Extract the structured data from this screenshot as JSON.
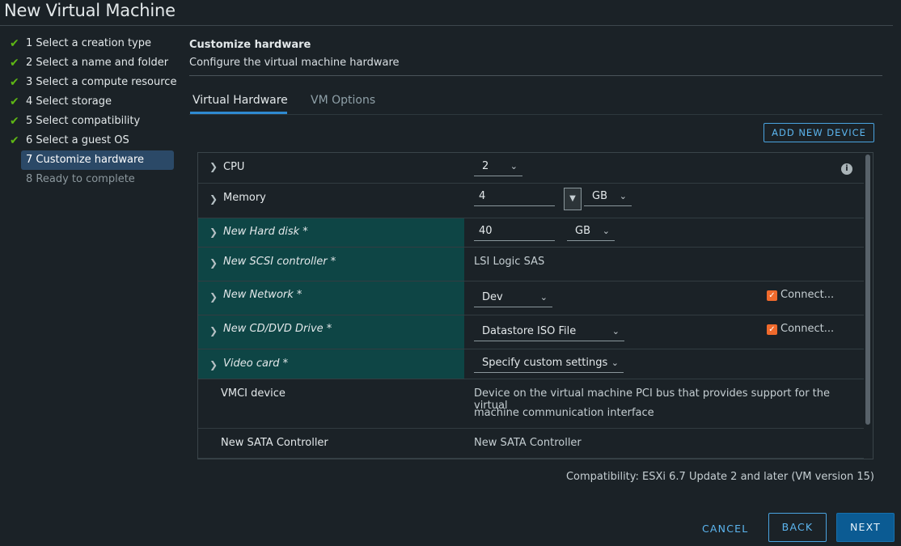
{
  "window": {
    "title": "New Virtual Machine"
  },
  "steps": [
    {
      "label": "1 Select a creation type",
      "state": "done"
    },
    {
      "label": "2 Select a name and folder",
      "state": "done"
    },
    {
      "label": "3 Select a compute resource",
      "state": "done"
    },
    {
      "label": "4 Select storage",
      "state": "done"
    },
    {
      "label": "5 Select compatibility",
      "state": "done"
    },
    {
      "label": "6 Select a guest OS",
      "state": "done"
    },
    {
      "label": "7 Customize hardware",
      "state": "active"
    },
    {
      "label": "8 Ready to complete",
      "state": "pending"
    }
  ],
  "header": {
    "title": "Customize hardware",
    "subtitle": "Configure the virtual machine hardware"
  },
  "tabs": [
    {
      "label": "Virtual Hardware",
      "active": true
    },
    {
      "label": "VM Options",
      "active": false
    }
  ],
  "toolbar": {
    "add_device_label": "ADD NEW DEVICE"
  },
  "hardware": {
    "cpu": {
      "label": "CPU",
      "value": "2"
    },
    "memory": {
      "label": "Memory",
      "value": "4",
      "unit": "GB"
    },
    "hard_disk": {
      "label": "New Hard disk *",
      "value": "40",
      "unit": "GB"
    },
    "scsi": {
      "label": "New SCSI controller *",
      "value": "LSI Logic SAS"
    },
    "network": {
      "label": "New Network *",
      "value": "Dev",
      "connect_label": "Connect...",
      "connected": true
    },
    "cdrom": {
      "label": "New CD/DVD Drive *",
      "value": "Datastore ISO File",
      "connect_label": "Connect...",
      "connected": true
    },
    "video": {
      "label": "Video card *",
      "value": "Specify custom settings"
    },
    "vmci": {
      "label": "VMCI device",
      "value_line1": "Device on the virtual machine PCI bus that provides support for the virtual",
      "value_line2": "machine communication interface"
    },
    "sata": {
      "label": "New SATA Controller",
      "value": "New SATA Controller"
    }
  },
  "compatibility": "Compatibility: ESXi 6.7 Update 2 and later (VM version 15)",
  "footer": {
    "cancel": "CANCEL",
    "back": "BACK",
    "next": "NEXT"
  },
  "colors": {
    "accent": "#5cb6f0",
    "new_row_bg": "#0e4545",
    "checkbox": "#f06a2c",
    "step_done": "#5eb715"
  },
  "icons": {
    "step_done": "check-icon",
    "expand": "chevron-right-icon",
    "dropdown": "chevron-down-icon",
    "info": "info-icon"
  }
}
